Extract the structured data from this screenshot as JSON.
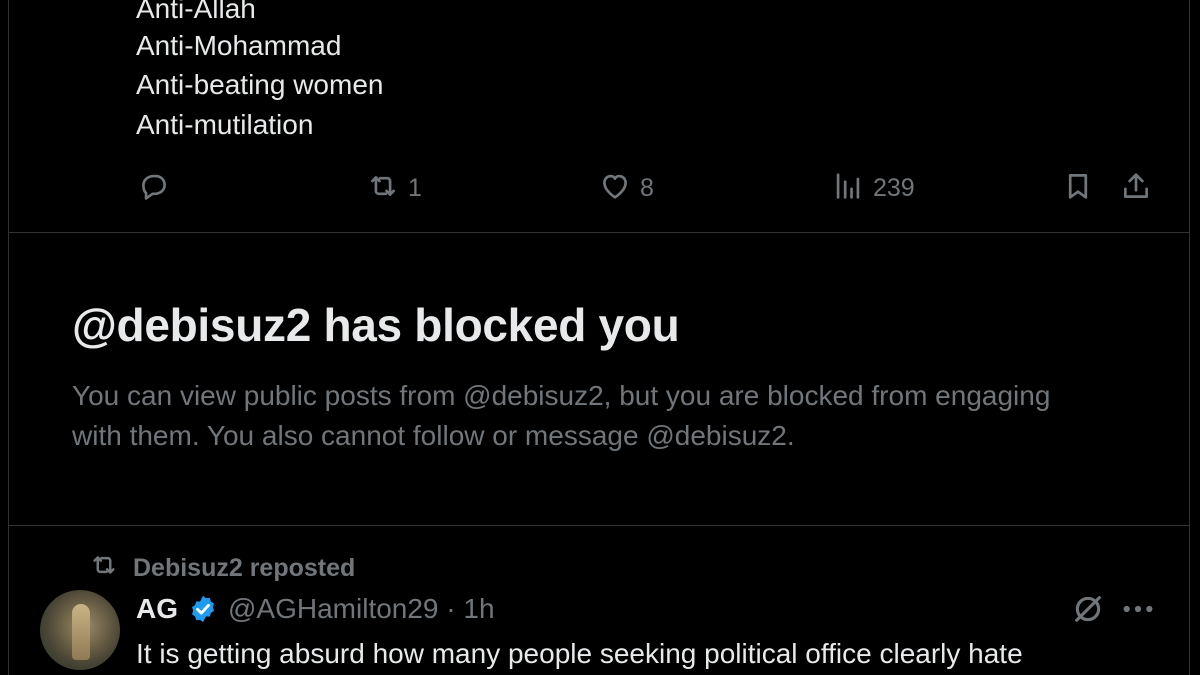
{
  "top_post": {
    "lines": [
      "Anti-Allah",
      "Anti-Mohammad",
      "Anti-beating women",
      "Anti-mutilation"
    ],
    "actions": {
      "reply_icon": "reply-icon",
      "repost_icon": "repost-icon",
      "repost_count": "1",
      "like_icon": "heart-icon",
      "like_count": "8",
      "views_icon": "views-icon",
      "views_count": "239",
      "bookmark_icon": "bookmark-icon",
      "share_icon": "share-icon"
    }
  },
  "block_notice": {
    "title": "@debisuz2 has blocked you",
    "description": "You can view public posts from @debisuz2, but you are blocked from engaging with them. You also cannot follow or message @debisuz2."
  },
  "reposted_post": {
    "repost_label": "Debisuz2 reposted",
    "author_name": "AG",
    "verified": true,
    "handle_time": "@AGHamilton29 · 1h",
    "text": "It is getting absurd how many people seeking political office clearly hate",
    "colors": {
      "verified_badge": "#1d9bf0",
      "muted_text": "#71767b"
    }
  }
}
